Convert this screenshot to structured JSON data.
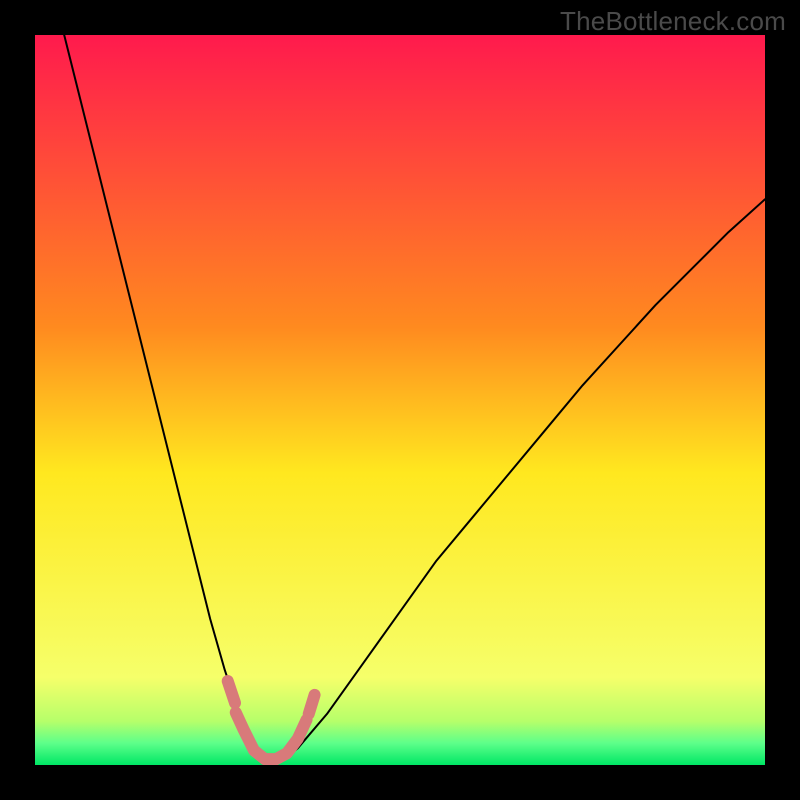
{
  "watermark": "TheBottleneck.com",
  "chart_data": {
    "type": "line",
    "title": "",
    "xlabel": "",
    "ylabel": "",
    "xlim": [
      0,
      100
    ],
    "ylim": [
      0,
      100
    ],
    "grid": false,
    "legend": false,
    "background_gradient": [
      {
        "y": 100,
        "color": "#ff1a4d"
      },
      {
        "y": 60,
        "color": "#ff8a1f"
      },
      {
        "y": 40,
        "color": "#ffe81f"
      },
      {
        "y": 12,
        "color": "#f6ff6a"
      },
      {
        "y": 6,
        "color": "#b6ff6a"
      },
      {
        "y": 3,
        "color": "#5eff8a"
      },
      {
        "y": 0,
        "color": "#00e765"
      }
    ],
    "series": [
      {
        "name": "bottleneck-curve",
        "color": "#000000",
        "stroke_width": 2,
        "x": [
          4,
          6,
          8,
          10,
          12,
          14,
          16,
          18,
          20,
          22,
          24,
          26,
          28,
          29,
          30,
          31,
          32,
          33,
          34,
          35,
          36,
          40,
          45,
          50,
          55,
          60,
          65,
          70,
          75,
          80,
          85,
          90,
          95,
          100
        ],
        "y": [
          100,
          92,
          84,
          76,
          68,
          60,
          52,
          44,
          36,
          28,
          20,
          13,
          7,
          4.5,
          2.8,
          1.7,
          1.2,
          1.0,
          1.1,
          1.5,
          2.3,
          7,
          14,
          21,
          28,
          34,
          40,
          46,
          52,
          57.5,
          63,
          68,
          73,
          77.5
        ]
      },
      {
        "name": "highlight-band",
        "color": "#d87a7a",
        "stroke_width": 12,
        "segments": [
          {
            "x": [
              27.5,
              28.6,
              30.0,
              31.5,
              33.0,
              34.5,
              36.0,
              37.2
            ],
            "y": [
              7.2,
              4.8,
              2.0,
              0.8,
              0.8,
              1.6,
              3.6,
              6.2
            ]
          },
          {
            "x": [
              26.4,
              27.4
            ],
            "y": [
              11.5,
              8.5
            ]
          },
          {
            "x": [
              37.5,
              38.3
            ],
            "y": [
              7.0,
              9.6
            ]
          }
        ]
      }
    ]
  }
}
